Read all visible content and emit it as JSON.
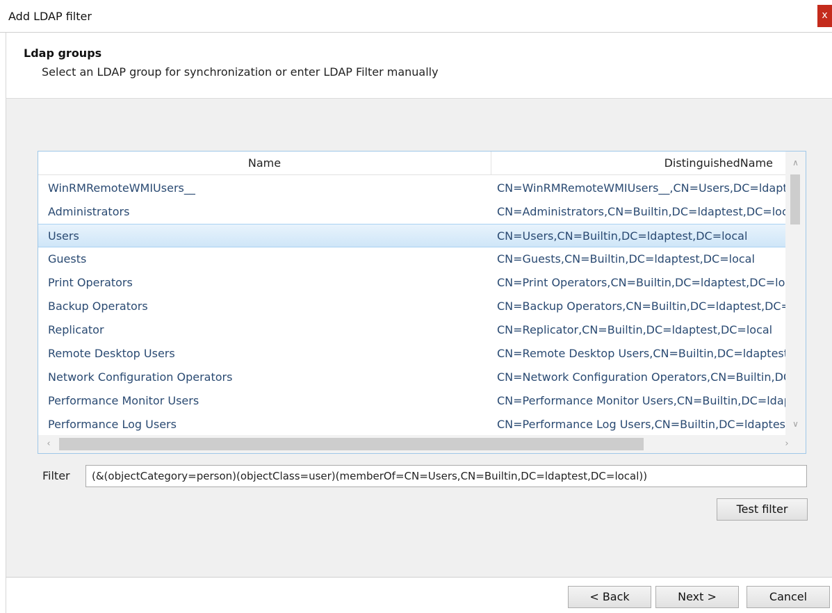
{
  "window": {
    "title": "Add LDAP filter",
    "close_glyph": "x"
  },
  "header": {
    "title": "Ldap groups",
    "subtitle": "Select an LDAP group for synchronization or enter LDAP Filter manually"
  },
  "grid": {
    "columns": [
      "Name",
      "DistinguishedName"
    ],
    "selected_index": 2,
    "rows": [
      {
        "name": "WinRMRemoteWMIUsers__",
        "dn": "CN=WinRMRemoteWMIUsers__,CN=Users,DC=ldaptest,DC=local"
      },
      {
        "name": "Administrators",
        "dn": "CN=Administrators,CN=Builtin,DC=ldaptest,DC=local"
      },
      {
        "name": "Users",
        "dn": "CN=Users,CN=Builtin,DC=ldaptest,DC=local"
      },
      {
        "name": "Guests",
        "dn": "CN=Guests,CN=Builtin,DC=ldaptest,DC=local"
      },
      {
        "name": "Print Operators",
        "dn": "CN=Print Operators,CN=Builtin,DC=ldaptest,DC=local"
      },
      {
        "name": "Backup Operators",
        "dn": "CN=Backup Operators,CN=Builtin,DC=ldaptest,DC=local"
      },
      {
        "name": "Replicator",
        "dn": "CN=Replicator,CN=Builtin,DC=ldaptest,DC=local"
      },
      {
        "name": "Remote Desktop Users",
        "dn": "CN=Remote Desktop Users,CN=Builtin,DC=ldaptest,DC=local"
      },
      {
        "name": "Network Configuration Operators",
        "dn": "CN=Network Configuration Operators,CN=Builtin,DC=ldaptest,DC=local"
      },
      {
        "name": "Performance Monitor Users",
        "dn": "CN=Performance Monitor Users,CN=Builtin,DC=ldaptest,DC=local"
      },
      {
        "name": "Performance Log Users",
        "dn": "CN=Performance Log Users,CN=Builtin,DC=ldaptest,DC=local"
      }
    ]
  },
  "filter": {
    "label": "Filter",
    "value": "(&(objectCategory=person)(objectClass=user)(memberOf=CN=Users,CN=Builtin,DC=ldaptest,DC=local))"
  },
  "buttons": {
    "test_filter": "Test filter",
    "back": "< Back",
    "next": "Next >",
    "cancel": "Cancel"
  },
  "icons": {
    "scroll_up": "chevron-up-icon",
    "scroll_down": "chevron-down-icon",
    "scroll_left": "chevron-left-icon",
    "scroll_right": "chevron-right-icon"
  },
  "colors": {
    "close_button": "#c42b1c",
    "selection_top": "#e8f3fc",
    "selection_bottom": "#cfe6f8",
    "link_text": "#2a4a72"
  }
}
